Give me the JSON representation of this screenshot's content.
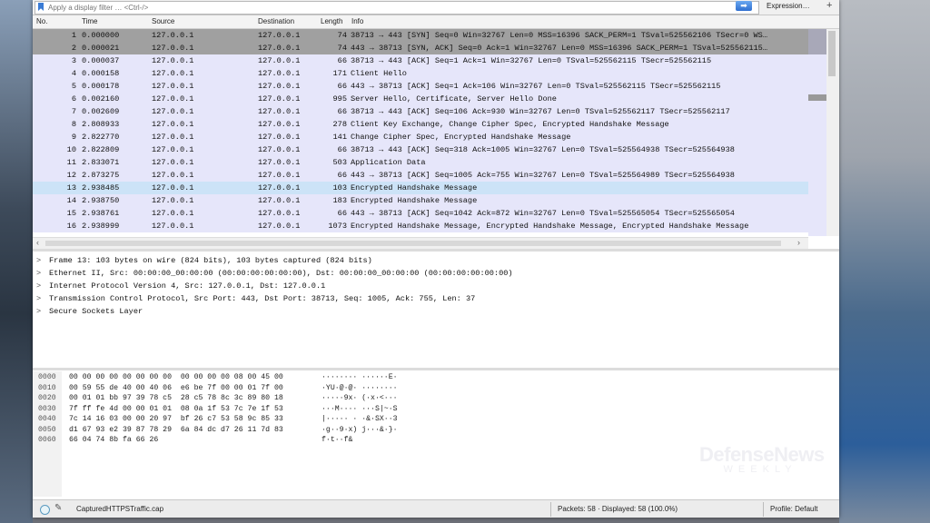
{
  "filter_bar": {
    "placeholder": "Apply a display filter … <Ctrl-/>",
    "apply_arrow": "➡",
    "expression_label": "Expression…",
    "add_label": "+"
  },
  "packet_list": {
    "columns": [
      "No.",
      "Time",
      "Source",
      "Destination",
      "Length",
      "Info"
    ],
    "rows": [
      {
        "no": "1",
        "time": "0.000000",
        "src": "127.0.0.1",
        "dst": "127.0.0.1",
        "len": "74",
        "info": "38713 → 443 [SYN] Seq=0 Win=32767 Len=0 MSS=16396 SACK_PERM=1 TSval=525562106 TSecr=0 WS…",
        "style": "syn"
      },
      {
        "no": "2",
        "time": "0.000021",
        "src": "127.0.0.1",
        "dst": "127.0.0.1",
        "len": "74",
        "info": "443 → 38713 [SYN, ACK] Seq=0 Ack=1 Win=32767 Len=0 MSS=16396 SACK_PERM=1 TSval=525562115…",
        "style": "syn"
      },
      {
        "no": "3",
        "time": "0.000037",
        "src": "127.0.0.1",
        "dst": "127.0.0.1",
        "len": "66",
        "info": "38713 → 443 [ACK] Seq=1 Ack=1 Win=32767 Len=0 TSval=525562115 TSecr=525562115",
        "style": "normal"
      },
      {
        "no": "4",
        "time": "0.000158",
        "src": "127.0.0.1",
        "dst": "127.0.0.1",
        "len": "171",
        "info": "Client Hello",
        "style": "normal"
      },
      {
        "no": "5",
        "time": "0.000178",
        "src": "127.0.0.1",
        "dst": "127.0.0.1",
        "len": "66",
        "info": "443 → 38713 [ACK] Seq=1 Ack=106 Win=32767 Len=0 TSval=525562115 TSecr=525562115",
        "style": "normal"
      },
      {
        "no": "6",
        "time": "0.002160",
        "src": "127.0.0.1",
        "dst": "127.0.0.1",
        "len": "995",
        "info": "Server Hello, Certificate, Server Hello Done",
        "style": "normal"
      },
      {
        "no": "7",
        "time": "0.002609",
        "src": "127.0.0.1",
        "dst": "127.0.0.1",
        "len": "66",
        "info": "38713 → 443 [ACK] Seq=106 Ack=930 Win=32767 Len=0 TSval=525562117 TSecr=525562117",
        "style": "normal"
      },
      {
        "no": "8",
        "time": "2.808933",
        "src": "127.0.0.1",
        "dst": "127.0.0.1",
        "len": "278",
        "info": "Client Key Exchange, Change Cipher Spec, Encrypted Handshake Message",
        "style": "normal"
      },
      {
        "no": "9",
        "time": "2.822770",
        "src": "127.0.0.1",
        "dst": "127.0.0.1",
        "len": "141",
        "info": "Change Cipher Spec, Encrypted Handshake Message",
        "style": "normal"
      },
      {
        "no": "10",
        "time": "2.822809",
        "src": "127.0.0.1",
        "dst": "127.0.0.1",
        "len": "66",
        "info": "38713 → 443 [ACK] Seq=318 Ack=1005 Win=32767 Len=0 TSval=525564938 TSecr=525564938",
        "style": "normal"
      },
      {
        "no": "11",
        "time": "2.833071",
        "src": "127.0.0.1",
        "dst": "127.0.0.1",
        "len": "503",
        "info": "Application Data",
        "style": "normal"
      },
      {
        "no": "12",
        "time": "2.873275",
        "src": "127.0.0.1",
        "dst": "127.0.0.1",
        "len": "66",
        "info": "443 → 38713 [ACK] Seq=1005 Ack=755 Win=32767 Len=0 TSval=525564989 TSecr=525564938",
        "style": "normal"
      },
      {
        "no": "13",
        "time": "2.938485",
        "src": "127.0.0.1",
        "dst": "127.0.0.1",
        "len": "103",
        "info": "Encrypted Handshake Message",
        "style": "sel"
      },
      {
        "no": "14",
        "time": "2.938750",
        "src": "127.0.0.1",
        "dst": "127.0.0.1",
        "len": "183",
        "info": "Encrypted Handshake Message",
        "style": "normal"
      },
      {
        "no": "15",
        "time": "2.938761",
        "src": "127.0.0.1",
        "dst": "127.0.0.1",
        "len": "66",
        "info": "443 → 38713 [ACK] Seq=1042 Ack=872 Win=32767 Len=0 TSval=525565054 TSecr=525565054",
        "style": "normal"
      },
      {
        "no": "16",
        "time": "2.938999",
        "src": "127.0.0.1",
        "dst": "127.0.0.1",
        "len": "1073",
        "info": "Encrypted Handshake Message, Encrypted Handshake Message, Encrypted Handshake Message",
        "style": "normal"
      }
    ]
  },
  "details": [
    {
      "arrow": ">",
      "text": "Frame 13: 103 bytes on wire (824 bits), 103 bytes captured (824 bits)"
    },
    {
      "arrow": ">",
      "text": "Ethernet II, Src: 00:00:00_00:00:00 (00:00:00:00:00:00), Dst: 00:00:00_00:00:00 (00:00:00:00:00:00)"
    },
    {
      "arrow": ">",
      "text": "Internet Protocol Version 4, Src: 127.0.0.1, Dst: 127.0.0.1"
    },
    {
      "arrow": ">",
      "text": "Transmission Control Protocol, Src Port: 443, Dst Port: 38713, Seq: 1005, Ack: 755, Len: 37"
    },
    {
      "arrow": ">",
      "text": "Secure Sockets Layer"
    }
  ],
  "hex": [
    {
      "off": "0000",
      "hex": "00 00 00 00 00 00 00 00  00 00 00 00 08 00 45 00",
      "ascii": "········ ······E·"
    },
    {
      "off": "0010",
      "hex": "00 59 55 de 40 00 40 06  e6 be 7f 00 00 01 7f 00",
      "ascii": "·YU·@·@· ········"
    },
    {
      "off": "0020",
      "hex": "00 01 01 bb 97 39 78 c5  28 c5 78 8c 3c 89 80 18",
      "ascii": "·····9x· (·x·<···"
    },
    {
      "off": "0030",
      "hex": "7f ff fe 4d 00 00 01 01  08 0a 1f 53 7c 7e 1f 53",
      "ascii": "···M···· ···S|~·S"
    },
    {
      "off": "0040",
      "hex": "7c 14 16 03 00 00 20 97  bf 26 c7 53 58 9c 85 33",
      "ascii": "|····· · ·&·SX··3"
    },
    {
      "off": "0050",
      "hex": "d1 67 93 e2 39 87 78 29  6a 84 dc d7 26 11 7d 83",
      "ascii": "·g··9·x) j···&·}·"
    },
    {
      "off": "0060",
      "hex": "66 04 74 8b fa 66 26",
      "ascii": "f·t··f&"
    }
  ],
  "status_bar": {
    "file": "CapturedHTTPSTraffic.cap",
    "packets": "Packets: 58 · Displayed: 58 (100.0%)",
    "profile": "Profile: Default"
  },
  "watermark": {
    "main": "DefenseNews",
    "sub": "WEEKLY"
  }
}
